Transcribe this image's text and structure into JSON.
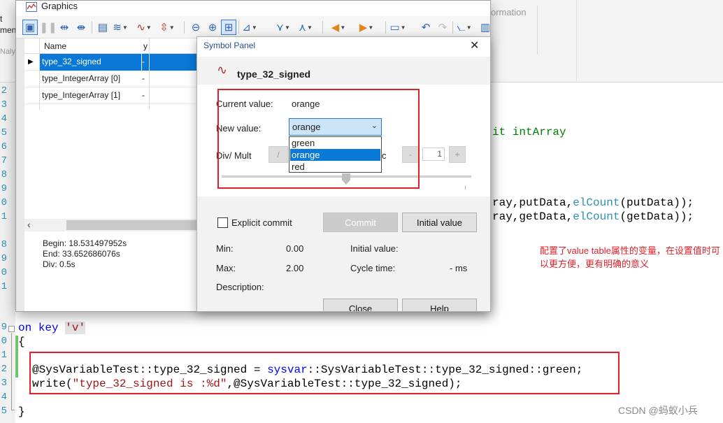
{
  "ribbon": {
    "frag_t": "t",
    "frag_ment": "ment",
    "frag_naly": "Naly:",
    "frag_ormation": "ormation"
  },
  "graphics_window": {
    "title": "Graphics",
    "columns": {
      "name": "Name",
      "y": "y"
    },
    "rows": [
      {
        "name": "type_32_signed",
        "y": "-"
      },
      {
        "name": "type_IntegerArray [0]",
        "y": "-"
      },
      {
        "name": "type_IntegerArray [1]",
        "y": "-"
      }
    ],
    "begin": "Begin: 18.531497952s",
    "end": "End: 33.652686076s",
    "div": "Div: 0.5s"
  },
  "symbol_panel": {
    "title": "Symbol Panel",
    "signal_name": "type_32_signed",
    "current_value_label": "Current value:",
    "current_value": "orange",
    "new_value_label": "New value:",
    "new_value_selected": "orange",
    "new_value_options": [
      "green",
      "orange",
      "red"
    ],
    "div_mult_label": "Div/ Mult",
    "div_button": "/",
    "inc_fragment": "c",
    "minus_button": "-",
    "step_value": "1",
    "plus_button": "+",
    "explicit_commit_label": "Explicit commit",
    "commit_button": "Commit",
    "initial_value_button": "Initial value",
    "min_label": "Min:",
    "min_value": "0.00",
    "max_label": "Max:",
    "max_value": "2.00",
    "initial_value_label": "Initial value:",
    "cycle_time_label": "Cycle time:",
    "cycle_time_value": "- ms",
    "description_label": "Description:",
    "close_button": "Close",
    "help_button": "Help"
  },
  "code": {
    "line_numbers": [
      "2",
      "3",
      "4",
      "5",
      "6",
      "7",
      "8",
      "9",
      "0",
      "1",
      "8",
      "9",
      "0",
      "1",
      "9",
      "0",
      "1",
      "2",
      "3",
      "4",
      "5"
    ],
    "frag_line_5": "it intArray",
    "frag_line_9_a": "ray,putData,",
    "frag_line_9_fn": "elCount",
    "frag_line_9_b": "(putData));",
    "frag_line_10_a": "ray,getData,",
    "frag_line_10_fn": "elCount",
    "frag_line_10_b": "(getData));",
    "on_kw": "on",
    "key_kw": "key",
    "key_char": "'v'",
    "open_brace": "{",
    "close_brace": "}",
    "assign_a": "@SysVariableTest::type_32_signed = ",
    "assign_kw": "sysvar",
    "assign_b": "::SysVariableTest::type_32_signed::green;",
    "write_fn": "write(",
    "write_str": "\"type_32_signed is :%d\"",
    "write_rest": ",@SysVariableTest::type_32_signed);"
  },
  "annotation": "配置了value table属性的变量，在设置值时可以更方便，更有明确的意义",
  "watermark": "CSDN @蚂蚁小兵",
  "icons": [
    "graphics-app-icon",
    "layout-icon",
    "pause-icon",
    "zoom-icon",
    "wave-icon",
    "close-icon",
    "signal-icon",
    "chevron-down-icon",
    "checkbox-icon"
  ],
  "colors": {
    "highlight": "#0a78d7",
    "annotation_red": "#e0202a",
    "keyword_blue": "#0000ff",
    "string_red": "#a31515"
  }
}
